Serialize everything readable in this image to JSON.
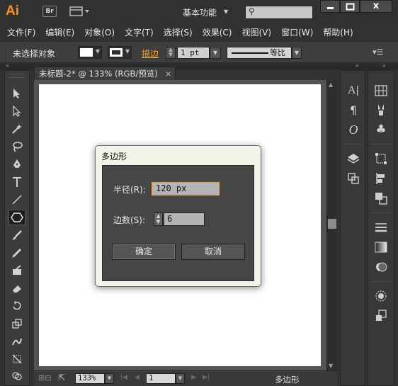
{
  "app": {
    "logo": "Ai",
    "bridge": "Br",
    "workspace": "基本功能",
    "close_glyph": "x"
  },
  "menu": [
    "文件(F)",
    "编辑(E)",
    "对象(O)",
    "文字(T)",
    "选择(S)",
    "效果(C)",
    "视图(V)",
    "窗口(W)",
    "帮助(H)"
  ],
  "control_bar": {
    "selection": "未选择对象",
    "stroke_label": "描边",
    "stroke_value": "1 pt",
    "profile": "等比"
  },
  "document": {
    "tab_title": "未标题-2* @ 133% (RGB/预览)",
    "close_glyph": "×"
  },
  "status": {
    "zoom": "133%",
    "artboard": "1",
    "tool": "多边形"
  },
  "dialog": {
    "title": "多边形",
    "radius_label": "半径(R):",
    "radius_value": "120 px",
    "sides_label": "边数(S):",
    "sides_value": "6",
    "ok_label": "确定",
    "cancel_label": "取消"
  },
  "colors": {
    "accent": "#f7931e",
    "stroke_label": "#e9a23b",
    "focus_border": "#e29b42"
  }
}
